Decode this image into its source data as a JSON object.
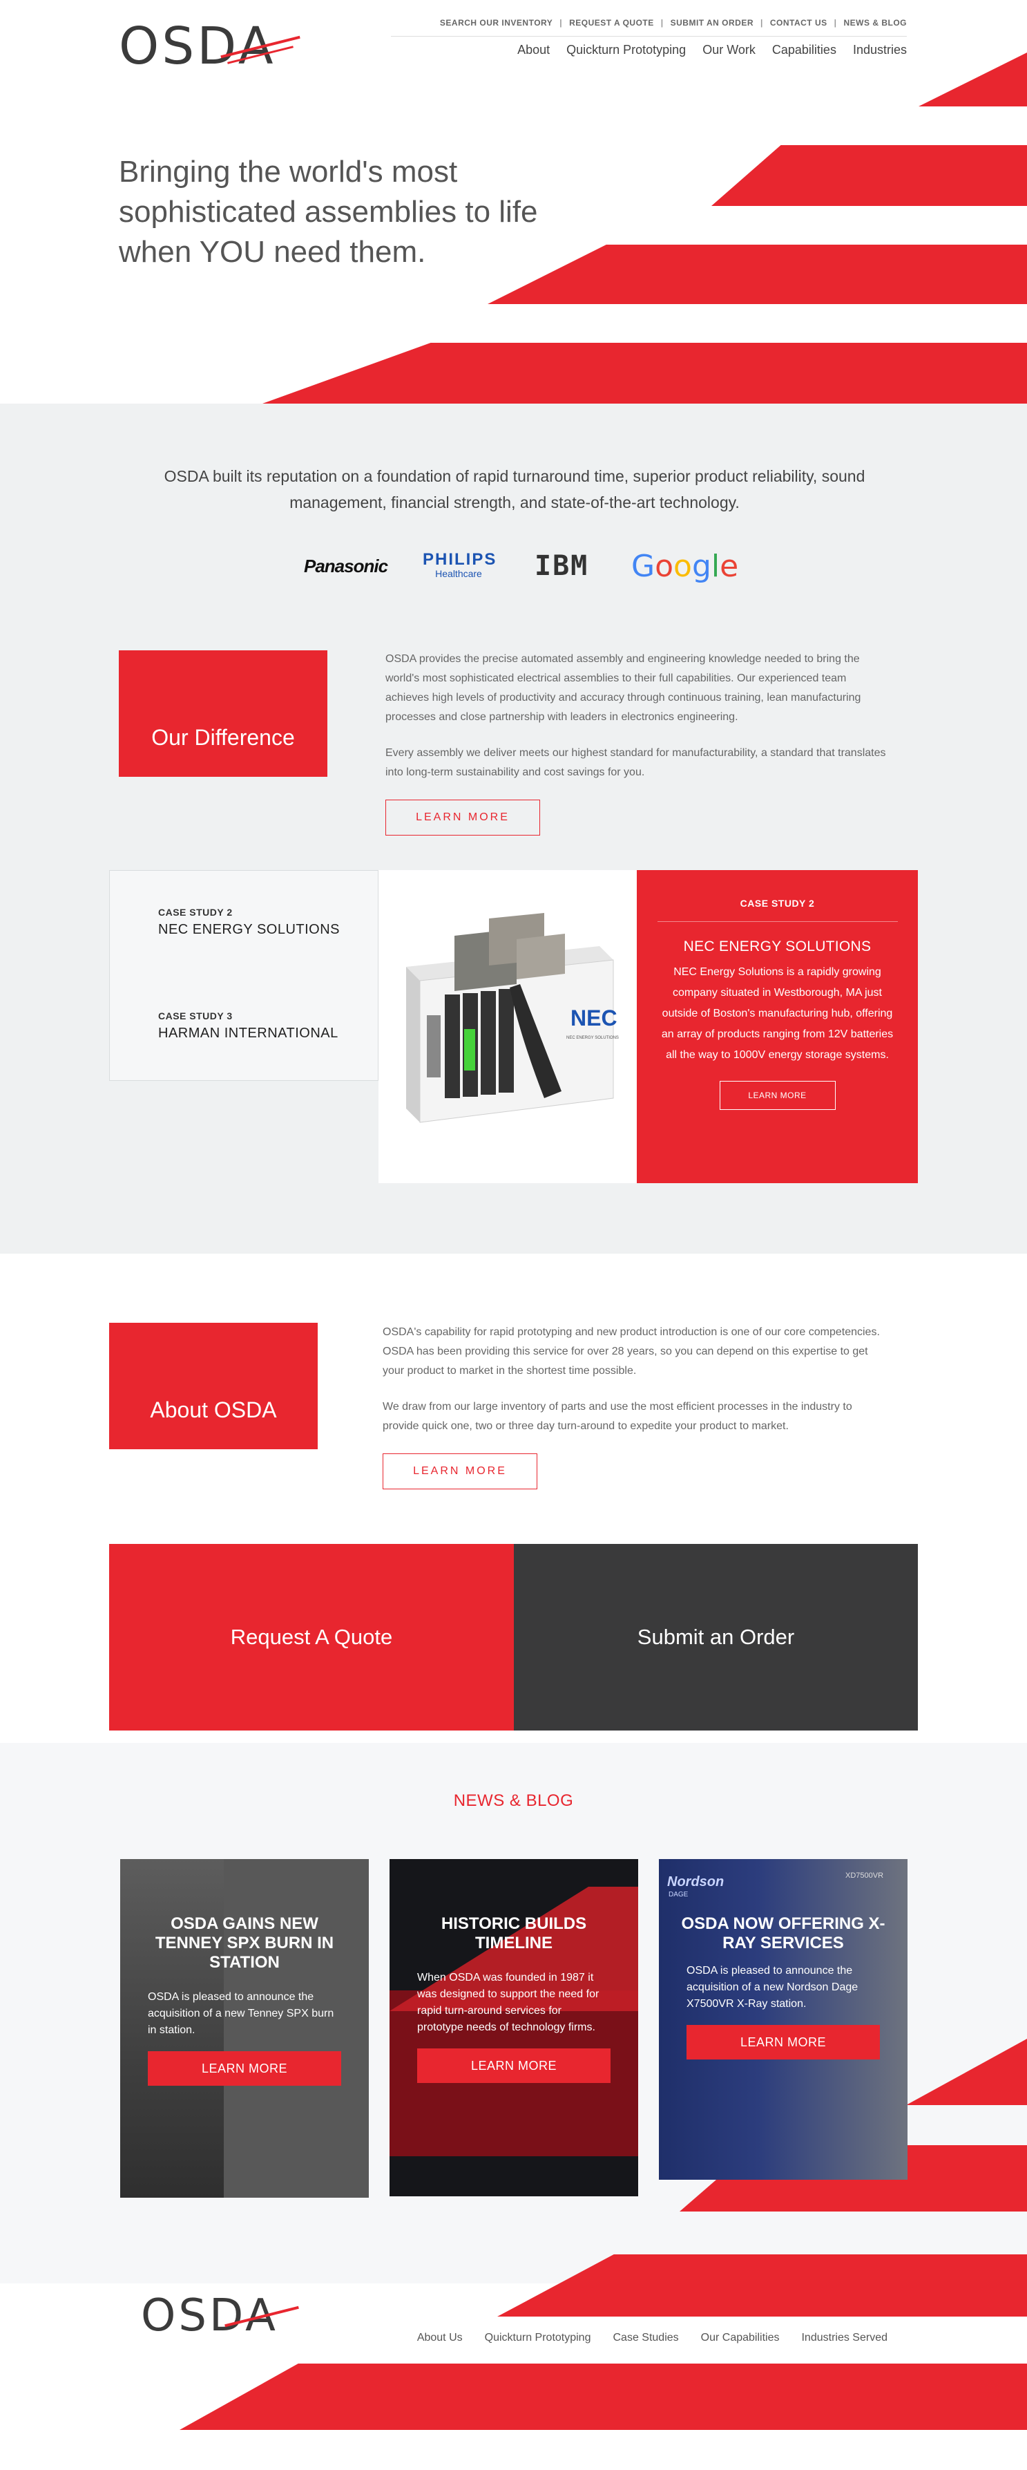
{
  "header": {
    "logo": "OSDA",
    "utility_nav": [
      "SEARCH OUR INVENTORY",
      "REQUEST A QUOTE",
      "SUBMIT AN ORDER",
      "CONTACT US",
      "NEWS & BLOG"
    ],
    "main_nav": [
      "About",
      "Quickturn Prototyping",
      "Our Work",
      "Capabilities",
      "Industries"
    ]
  },
  "hero": {
    "heading": "Bringing the world's most sophisticated assemblies to life when YOU need them."
  },
  "reputation": {
    "text": "OSDA built its reputation on a foundation of rapid turnaround time, superior product reliability, sound management, financial strength, and state-of-the-art technology.",
    "clients": {
      "panasonic": "Panasonic",
      "philips": "PHILIPS",
      "philips_sub": "Healthcare",
      "ibm": "IBM",
      "google": [
        "G",
        "o",
        "o",
        "g",
        "l",
        "e"
      ]
    }
  },
  "difference": {
    "title": "Our Difference",
    "p1": "OSDA provides the precise automated assembly and engineering knowledge needed to bring the world's most sophisticated electrical assemblies to their full capabilities. Our experienced team achieves high levels of productivity and accuracy through continuous training, lean manufacturing processes and close partnership with leaders in electronics engineering.",
    "p2": "Every assembly we deliver meets our highest standard for manufacturability, a standard that translates into long-term sustainability and cost savings for you.",
    "button": "LEARN MORE"
  },
  "case_studies": {
    "items": [
      {
        "kicker": "CASE STUDY 2",
        "title": "NEC ENERGY SOLUTIONS"
      },
      {
        "kicker": "CASE STUDY 3",
        "title": "HARMAN INTERNATIONAL"
      }
    ],
    "image_label": "NEC",
    "image_sublabel": "NEC ENERGY SOLUTIONS",
    "active": {
      "kicker": "CASE STUDY 2",
      "title": "NEC ENERGY SOLUTIONS",
      "description": "NEC Energy Solutions is a rapidly growing company situated in Westborough, MA just outside of Boston's manufacturing hub, offering an array of products ranging from 12V batteries all the way to 1000V energy storage systems.",
      "button": "LEARN MORE"
    }
  },
  "about": {
    "title": "About OSDA",
    "p1": "OSDA's capability for rapid prototyping and new product introduction is one of our core competencies. OSDA has been providing this service for over 28 years, so you can depend on this expertise to get your product to market in the shortest time possible.",
    "p2": "We draw from our large inventory of parts and use the most efficient processes in the industry to provide quick one, two or three day turn-around to expedite your product to market.",
    "button": "LEARN MORE"
  },
  "cta": {
    "quote": "Request A Quote",
    "order": "Submit an Order"
  },
  "news": {
    "title": "NEWS & BLOG",
    "cards": [
      {
        "title": "OSDA GAINS NEW TENNEY SPX BURN IN STATION",
        "text": "OSDA is pleased to announce the acquisition of a new Tenney SPX burn in station.",
        "button": "LEARN MORE"
      },
      {
        "title": "HISTORIC BUILDS TIMELINE",
        "text": "When OSDA was founded in 1987 it was designed to support the need for rapid turn-around services for prototype needs of technology firms.",
        "button": "LEARN MORE"
      },
      {
        "title": "OSDA NOW OFFERING X-RAY SERVICES",
        "text": "OSDA is pleased to announce the acquisition of a new Nordson Dage X7500VR X-Ray station.",
        "button": "LEARN MORE"
      }
    ],
    "machine_brand": "Nordson",
    "machine_sub": "DAGE",
    "machine_model": "XD7500VR"
  },
  "footer": {
    "logo": "OSDA",
    "nav": [
      "About Us",
      "Quickturn Prototyping",
      "Case Studies",
      "Our Capabilities",
      "Industries Served"
    ]
  },
  "colors": {
    "brand_red": "#e8262f",
    "dark": "#3a3a3b",
    "grey_bg": "#eff1f2"
  }
}
